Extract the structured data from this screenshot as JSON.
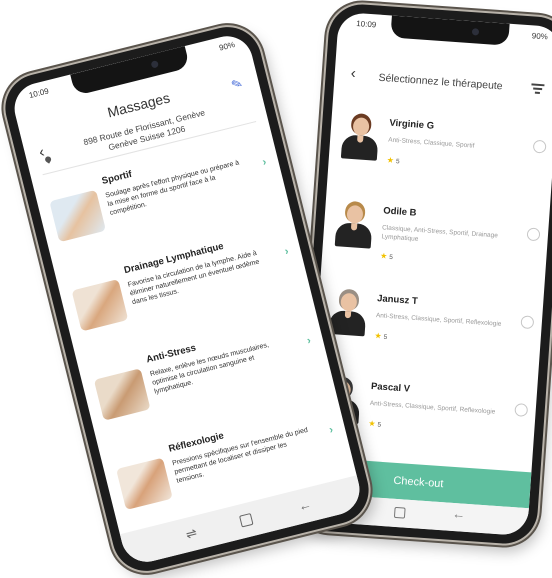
{
  "therapists_screen": {
    "status_time": "10:09",
    "status_battery": "90%",
    "title": "Sélectionnez le thérapeute",
    "therapists": [
      {
        "name": "Virginie G",
        "specialties": "Anti-Stress, Classique, Sportif",
        "rating": "5",
        "hair_color": "#6b3b22"
      },
      {
        "name": "Odile B",
        "specialties": "Classique, Anti-Stress, Sportif, Drainage Lymphatique",
        "rating": "5",
        "hair_color": "#b88a4a"
      },
      {
        "name": "Janusz T",
        "specialties": "Anti-Stress, Classique, Sportif, Reflexologie",
        "rating": "5",
        "hair_color": "#9a8f84"
      },
      {
        "name": "Pascal V",
        "specialties": "Anti-Stress, Classique, Sportif, Reflexologie",
        "rating": "5",
        "hair_color": "#3a3a3a"
      }
    ],
    "checkout_label": "Check-out",
    "accent_color": "#5fbf9f"
  },
  "massages_screen": {
    "status_time": "10:09",
    "status_battery": "90%",
    "title": "Massages",
    "address_line1": "898 Route de Florissant, Genève",
    "address_line2": "Genève Suisse 1206",
    "categories": [
      {
        "name": "Sportif",
        "description": "Soulage après l'effort physique ou prépare à la mise en forme du sportif face à la compétition.",
        "thumb_colors": [
          "#dfe9f1",
          "#e6c2a0"
        ]
      },
      {
        "name": "Drainage Lymphatique",
        "description": "Favorise la circulation de la lymphe. Aide à éliminer naturellement un éventuel œdème dans les tissus.",
        "thumb_colors": [
          "#efe2d4",
          "#d9a77e"
        ]
      },
      {
        "name": "Anti-Stress",
        "description": "Relaxe, enlève les nœuds musculaires, optimise la circulation sanguine et lymphatique.",
        "thumb_colors": [
          "#eadbc9",
          "#c99b73"
        ]
      },
      {
        "name": "Réflexologie",
        "description": "Pressions spécifiques sur l'ensemble du pied permettant de localiser et dissiper les tensions.",
        "thumb_colors": [
          "#f1e6da",
          "#d8a27a"
        ]
      }
    ]
  }
}
